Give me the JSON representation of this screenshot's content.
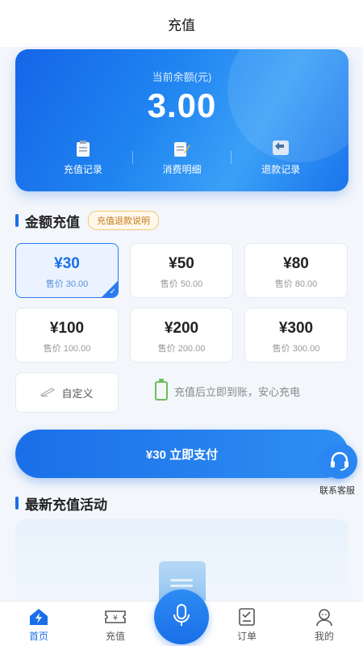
{
  "header": {
    "title": "充值"
  },
  "balance": {
    "label": "当前余额(元)",
    "amount": "3.00",
    "actions": [
      {
        "label": "充值记录",
        "icon": "clipboard-icon"
      },
      {
        "label": "消费明细",
        "icon": "memo-icon"
      },
      {
        "label": "退款记录",
        "icon": "return-arrow-icon"
      }
    ]
  },
  "recharge": {
    "title": "金额充值",
    "refund_tag": "充值退款说明",
    "options": [
      {
        "price": "¥30",
        "sale": "售价 30.00",
        "selected": true
      },
      {
        "price": "¥50",
        "sale": "售价 50.00",
        "selected": false
      },
      {
        "price": "¥80",
        "sale": "售价 80.00",
        "selected": false
      },
      {
        "price": "¥100",
        "sale": "售价 100.00",
        "selected": false
      },
      {
        "price": "¥200",
        "sale": "售价 200.00",
        "selected": false
      },
      {
        "price": "¥300",
        "sale": "售价 300.00",
        "selected": false
      }
    ],
    "custom_label": "自定义",
    "notice": "充值后立即到账，安心充电",
    "pay_button": "¥30 立即支付"
  },
  "service": {
    "label": "联系客服"
  },
  "activities": {
    "title": "最新充值活动"
  },
  "tabbar": {
    "items": [
      {
        "label": "首页",
        "icon": "home-lightning-icon",
        "active": true
      },
      {
        "label": "充值",
        "icon": "ticket-yen-icon",
        "active": false
      },
      {
        "label": "订单",
        "icon": "order-list-icon",
        "active": false
      },
      {
        "label": "我的",
        "icon": "user-icon",
        "active": false
      }
    ],
    "center_icon": "microphone-icon"
  },
  "colors": {
    "primary": "#1a6fe8",
    "tag_text": "#c47a1d",
    "battery_green": "#6dbb5d"
  }
}
